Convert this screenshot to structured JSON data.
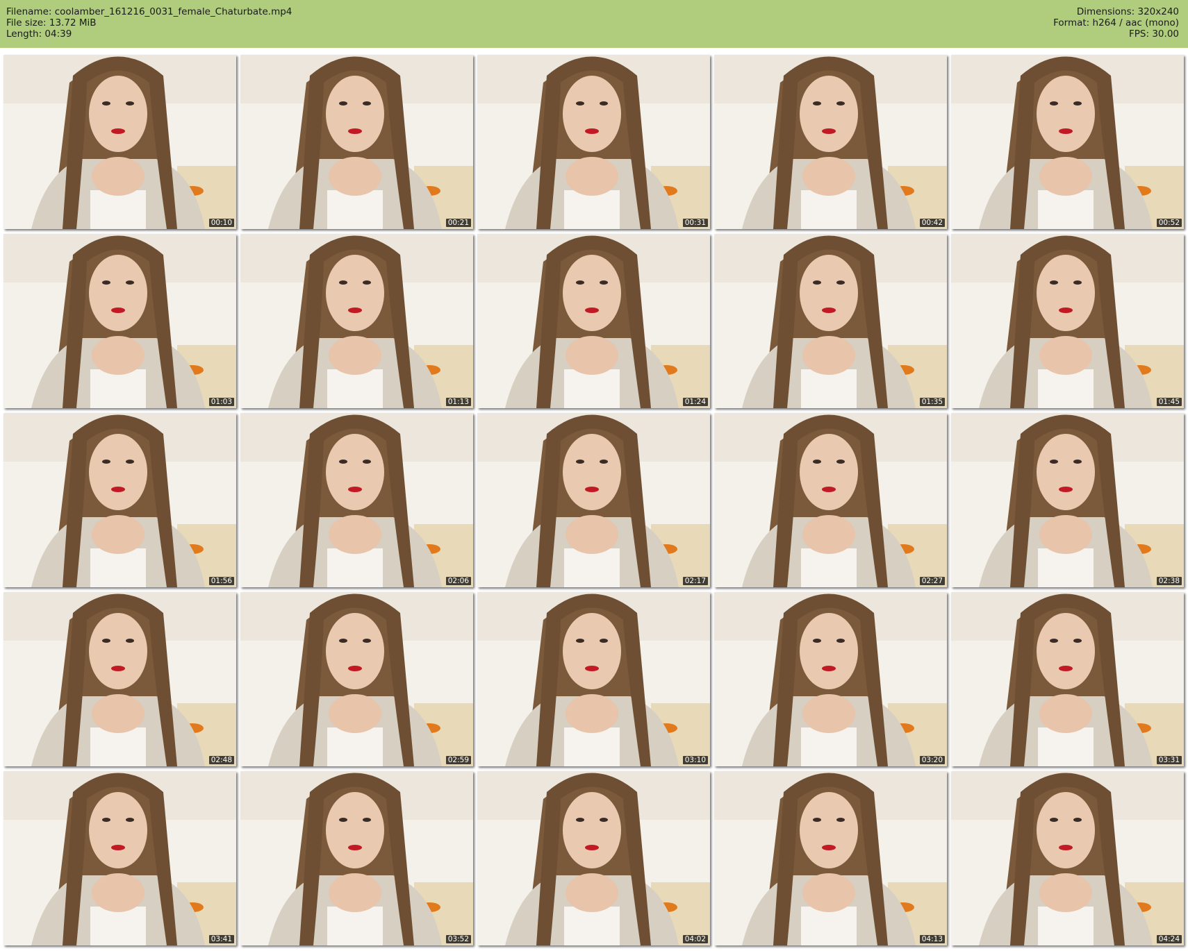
{
  "header": {
    "filename": "Filename: coolamber_161216_0031_female_Chaturbate.mp4",
    "filesize": "File size: 13.72 MiB",
    "length": "Length: 04:39",
    "dimensions": "Dimensions: 320x240",
    "format": "Format: h264 / aac (mono)",
    "fps": "FPS: 30.00"
  },
  "colors": {
    "header_bg": "#afcd7d"
  },
  "thumbnails": [
    {
      "time": "00:10"
    },
    {
      "time": "00:21"
    },
    {
      "time": "00:31"
    },
    {
      "time": "00:42"
    },
    {
      "time": "00:52"
    },
    {
      "time": "01:03"
    },
    {
      "time": "01:13"
    },
    {
      "time": "01:24"
    },
    {
      "time": "01:35"
    },
    {
      "time": "01:45"
    },
    {
      "time": "01:56"
    },
    {
      "time": "02:06"
    },
    {
      "time": "02:17"
    },
    {
      "time": "02:27"
    },
    {
      "time": "02:38"
    },
    {
      "time": "02:48"
    },
    {
      "time": "02:59"
    },
    {
      "time": "03:10"
    },
    {
      "time": "03:20"
    },
    {
      "time": "03:31"
    },
    {
      "time": "03:41"
    },
    {
      "time": "03:52"
    },
    {
      "time": "04:02"
    },
    {
      "time": "04:13"
    },
    {
      "time": "04:24"
    }
  ]
}
